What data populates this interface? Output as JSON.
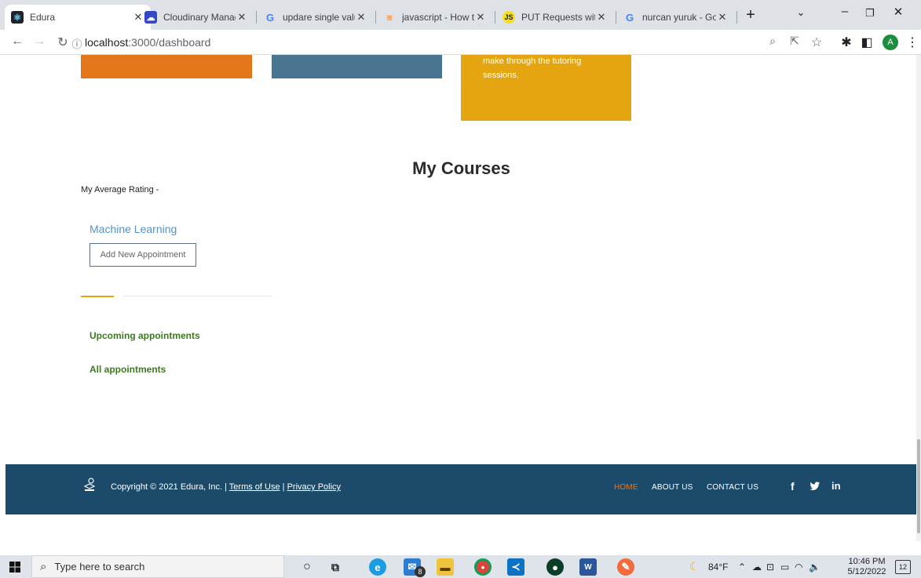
{
  "browser": {
    "tabs": [
      {
        "title": "Edura",
        "active": true
      },
      {
        "title": "Cloudinary Manage",
        "active": false
      },
      {
        "title": "updare single value",
        "active": false
      },
      {
        "title": "javascript - How to",
        "active": false
      },
      {
        "title": "PUT Requests with",
        "active": false
      },
      {
        "title": "nurcan yuruk - Goo",
        "active": false
      }
    ],
    "new_tab": "+",
    "url_host": "localhost",
    "url_path": ":3000/dashboard",
    "profile_initial": "A"
  },
  "cards": {
    "card3_line1": "make through the tutoring",
    "card3_line2": "sessions."
  },
  "colors": {
    "orange": "#e3761b",
    "slate": "#4a7590",
    "gold": "#e5a510",
    "footer": "#1c4a6b",
    "green": "#3c7a1e",
    "link_blue": "#5293c7"
  },
  "courses": {
    "heading": "My Courses",
    "avg_rating": "My Average Rating -",
    "course_name": "Machine Learning",
    "add_button": "Add New Appointment",
    "upcoming": "Upcoming appointments",
    "all": "All appointments"
  },
  "footer": {
    "copyright": "Copyright © 2021 Edura, Inc. | ",
    "terms": "Terms of Use",
    "sep": " | ",
    "privacy": "Privacy Policy",
    "nav_home": "HOME",
    "nav_about": "ABOUT US",
    "nav_contact": "CONTACT US",
    "social_fb": "f",
    "social_tw": "🐦",
    "social_in": "in"
  },
  "taskbar": {
    "search_placeholder": "Type here to search",
    "mail_badge": "8",
    "weather": "84°F",
    "time": "10:46 PM",
    "date": "5/12/2022",
    "notif_count": "12"
  }
}
